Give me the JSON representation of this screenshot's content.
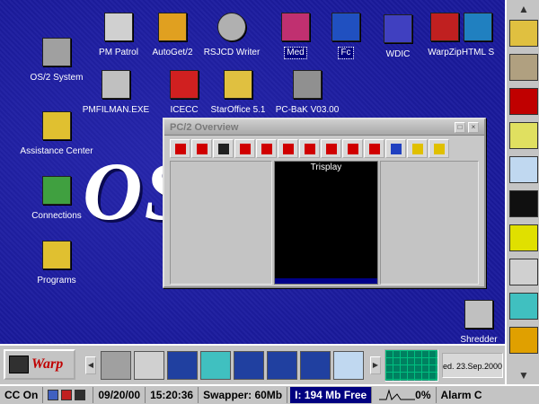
{
  "desktop": {
    "logo_text": "OS",
    "icons": [
      {
        "label": "OS/2 System",
        "color": "#a0a0a0"
      },
      {
        "label": "PM Patrol",
        "color": "#d0d0d0"
      },
      {
        "label": "AutoGet/2",
        "color": "#e0a020"
      },
      {
        "label": "RSJCD Writer",
        "color": "#b0b0b0"
      },
      {
        "label": "Med",
        "color": "#c03070"
      },
      {
        "label": "Fc",
        "color": "#2050c0"
      },
      {
        "label": "WDIC",
        "color": "#4040c0"
      },
      {
        "label": "WarpZip",
        "color": "#c02020"
      },
      {
        "label": "HTML S",
        "color": "#2080c0"
      },
      {
        "label": "PMFILMAN.EXE",
        "color": "#c0c0c0"
      },
      {
        "label": "ICECC",
        "color": "#d02020"
      },
      {
        "label": "StarOffice 5.1",
        "color": "#e0c040"
      },
      {
        "label": "PC-BaK V03.00",
        "color": "#909090"
      },
      {
        "label": "Assistance Center",
        "color": "#e0c030"
      },
      {
        "label": "Connections",
        "color": "#40a040"
      },
      {
        "label": "Programs",
        "color": "#e0c030"
      },
      {
        "label": "Shredder",
        "color": "#c0c0c0"
      }
    ]
  },
  "window": {
    "title": "PC/2 Overview",
    "minimize_glyph": "□",
    "close_glyph": "×",
    "tools": [
      {
        "icon": "exit-arrow-icon",
        "color": "#d00000"
      },
      {
        "icon": "move-cross-icon",
        "color": "#d00000"
      },
      {
        "icon": "maximize-corners-icon",
        "color": "#202020"
      },
      {
        "icon": "move-up-icon",
        "color": "#d00000"
      },
      {
        "icon": "move-down-icon",
        "color": "#d00000"
      },
      {
        "icon": "skull-kill-icon",
        "color": "#d00000"
      },
      {
        "icon": "arrow-northeast-icon",
        "color": "#d00000"
      },
      {
        "icon": "arrow-southwest-icon",
        "color": "#d00000"
      },
      {
        "icon": "close-x-icon",
        "color": "#d00000"
      },
      {
        "icon": "record-dot-icon",
        "color": "#d00000"
      },
      {
        "icon": "edit-page-icon",
        "color": "#2040c0"
      },
      {
        "icon": "arrow-right-yellow-icon",
        "color": "#e0c000"
      },
      {
        "icon": "lightbulb-icon",
        "color": "#e0c000"
      }
    ],
    "session_title": "Trisplay"
  },
  "dock": {
    "up_glyph": "▲",
    "down_glyph": "▼",
    "items": [
      {
        "icon": "folder-dock-icon",
        "color": "#e0c040"
      },
      {
        "icon": "person-reading-icon",
        "color": "#b0a080"
      },
      {
        "icon": "bookmark-b-icon",
        "color": "#c00000"
      },
      {
        "icon": "notes-icon",
        "color": "#e0e060"
      },
      {
        "icon": "ice-icon",
        "color": "#c0d8f0"
      },
      {
        "icon": "black-cat-icon",
        "color": "#101010"
      },
      {
        "icon": "smiley-icon",
        "color": "#e0e000"
      },
      {
        "icon": "ctrl-alt-del-icon",
        "color": "#d0d0d0"
      },
      {
        "icon": "window-list-icon",
        "color": "#40c0c0"
      },
      {
        "icon": "paint-icon",
        "color": "#e0a000"
      }
    ]
  },
  "launchpad": {
    "warp_label": "Warp",
    "left_glyph": "◀",
    "right_glyph": "▶",
    "items": [
      {
        "icon": "desk-drive-icon",
        "color": "#a0a0a0"
      },
      {
        "icon": "help-question-icon",
        "color": "#d0d0d0"
      },
      {
        "icon": "dos-prompt-icon",
        "color": "#2040a0"
      },
      {
        "icon": "window-arrows-icon",
        "color": "#40c0c0"
      },
      {
        "icon": "os2-window-icon",
        "color": "#2040a0"
      },
      {
        "icon": "os2-fullscreen-icon",
        "color": "#2040a0"
      },
      {
        "icon": "dos-window-icon",
        "color": "#2040a0"
      },
      {
        "icon": "ice-launch-icon",
        "color": "#c0d8f0"
      }
    ],
    "date_text": "ed. 23.Sep.2000"
  },
  "statusbar": {
    "cc": "CC On",
    "date": "09/20/00",
    "time": "15:20:36",
    "swapper": "Swapper: 60Mb",
    "free": "I: 194 Mb Free",
    "cpu": "0%",
    "alarm": "Alarm C"
  }
}
